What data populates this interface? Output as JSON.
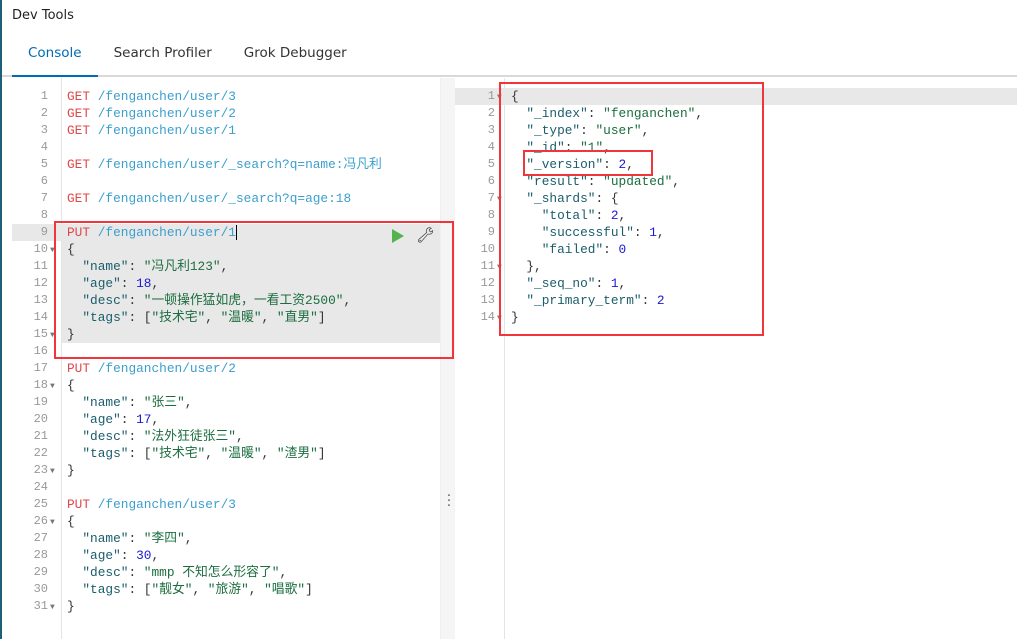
{
  "app": {
    "title": "Dev Tools"
  },
  "tabs": [
    {
      "label": "Console",
      "active": true
    },
    {
      "label": "Search Profiler"
    },
    {
      "label": "Grok Debugger"
    }
  ],
  "colors": {
    "accent": "#006bb4",
    "highlight_box": "#f0363a",
    "method": "#e0484a",
    "url": "#3b9fcd"
  },
  "editor": {
    "fold_lines": [
      10,
      15,
      18,
      23,
      26,
      31
    ],
    "active_line": 9,
    "lines": [
      [
        [
          "m",
          "GET"
        ],
        [
          "u",
          " /fenganchen/user/3"
        ]
      ],
      [
        [
          "m",
          "GET"
        ],
        [
          "u",
          " /fenganchen/user/2"
        ]
      ],
      [
        [
          "m",
          "GET"
        ],
        [
          "u",
          " /fenganchen/user/1"
        ]
      ],
      [],
      [
        [
          "m",
          "GET"
        ],
        [
          "u",
          " /fenganchen/user/_search?q=name:冯凡利"
        ]
      ],
      [],
      [
        [
          "m",
          "GET"
        ],
        [
          "u",
          " /fenganchen/user/_search?q=age:18"
        ]
      ],
      [],
      [
        [
          "m",
          "PUT"
        ],
        [
          "u",
          " /fenganchen/user/1"
        ]
      ],
      [
        [
          "p",
          "{"
        ]
      ],
      [
        [
          "p",
          "  "
        ],
        [
          "k",
          "\"name\""
        ],
        [
          "p",
          ": "
        ],
        [
          "s",
          "\"冯凡利123\""
        ],
        [
          "p",
          ","
        ]
      ],
      [
        [
          "p",
          "  "
        ],
        [
          "k",
          "\"age\""
        ],
        [
          "p",
          ": "
        ],
        [
          "n",
          "18"
        ],
        [
          "p",
          ","
        ]
      ],
      [
        [
          "p",
          "  "
        ],
        [
          "k",
          "\"desc\""
        ],
        [
          "p",
          ": "
        ],
        [
          "s",
          "\"一顿操作猛如虎，一看工资2500\""
        ],
        [
          "p",
          ","
        ]
      ],
      [
        [
          "p",
          "  "
        ],
        [
          "k",
          "\"tags\""
        ],
        [
          "p",
          ": ["
        ],
        [
          "s",
          "\"技术宅\""
        ],
        [
          "p",
          ", "
        ],
        [
          "s",
          "\"温暖\""
        ],
        [
          "p",
          ", "
        ],
        [
          "s",
          "\"直男\""
        ],
        [
          "p",
          "]"
        ]
      ],
      [
        [
          "p",
          "}"
        ]
      ],
      [],
      [
        [
          "m",
          "PUT"
        ],
        [
          "u",
          " /fenganchen/user/2"
        ]
      ],
      [
        [
          "p",
          "{"
        ]
      ],
      [
        [
          "p",
          "  "
        ],
        [
          "k",
          "\"name\""
        ],
        [
          "p",
          ": "
        ],
        [
          "s",
          "\"张三\""
        ],
        [
          "p",
          ","
        ]
      ],
      [
        [
          "p",
          "  "
        ],
        [
          "k",
          "\"age\""
        ],
        [
          "p",
          ": "
        ],
        [
          "n",
          "17"
        ],
        [
          "p",
          ","
        ]
      ],
      [
        [
          "p",
          "  "
        ],
        [
          "k",
          "\"desc\""
        ],
        [
          "p",
          ": "
        ],
        [
          "s",
          "\"法外狂徒张三\""
        ],
        [
          "p",
          ","
        ]
      ],
      [
        [
          "p",
          "  "
        ],
        [
          "k",
          "\"tags\""
        ],
        [
          "p",
          ": ["
        ],
        [
          "s",
          "\"技术宅\""
        ],
        [
          "p",
          ", "
        ],
        [
          "s",
          "\"温暖\""
        ],
        [
          "p",
          ", "
        ],
        [
          "s",
          "\"渣男\""
        ],
        [
          "p",
          "]"
        ]
      ],
      [
        [
          "p",
          "}"
        ]
      ],
      [],
      [
        [
          "m",
          "PUT"
        ],
        [
          "u",
          " /fenganchen/user/3"
        ]
      ],
      [
        [
          "p",
          "{"
        ]
      ],
      [
        [
          "p",
          "  "
        ],
        [
          "k",
          "\"name\""
        ],
        [
          "p",
          ": "
        ],
        [
          "s",
          "\"李四\""
        ],
        [
          "p",
          ","
        ]
      ],
      [
        [
          "p",
          "  "
        ],
        [
          "k",
          "\"age\""
        ],
        [
          "p",
          ": "
        ],
        [
          "n",
          "30"
        ],
        [
          "p",
          ","
        ]
      ],
      [
        [
          "p",
          "  "
        ],
        [
          "k",
          "\"desc\""
        ],
        [
          "p",
          ": "
        ],
        [
          "s",
          "\"mmp 不知怎么形容了\""
        ],
        [
          "p",
          ","
        ]
      ],
      [
        [
          "p",
          "  "
        ],
        [
          "k",
          "\"tags\""
        ],
        [
          "p",
          ": ["
        ],
        [
          "s",
          "\"靓女\""
        ],
        [
          "p",
          ", "
        ],
        [
          "s",
          "\"旅游\""
        ],
        [
          "p",
          ", "
        ],
        [
          "s",
          "\"唱歌\""
        ],
        [
          "p",
          "]"
        ]
      ],
      [
        [
          "p",
          "}"
        ]
      ]
    ]
  },
  "output": {
    "fold_lines": [
      1,
      7,
      11,
      14
    ],
    "lines": [
      [
        [
          "p",
          "{"
        ]
      ],
      [
        [
          "p",
          "  "
        ],
        [
          "k",
          "\"_index\""
        ],
        [
          "p",
          ": "
        ],
        [
          "s",
          "\"fenganchen\""
        ],
        [
          "p",
          ","
        ]
      ],
      [
        [
          "p",
          "  "
        ],
        [
          "k",
          "\"_type\""
        ],
        [
          "p",
          ": "
        ],
        [
          "s",
          "\"user\""
        ],
        [
          "p",
          ","
        ]
      ],
      [
        [
          "p",
          "  "
        ],
        [
          "k",
          "\"_id\""
        ],
        [
          "p",
          ": "
        ],
        [
          "s",
          "\"1\""
        ],
        [
          "p",
          ","
        ]
      ],
      [
        [
          "p",
          "  "
        ],
        [
          "k",
          "\"_version\""
        ],
        [
          "p",
          ": "
        ],
        [
          "n",
          "2"
        ],
        [
          "p",
          ","
        ]
      ],
      [
        [
          "p",
          "  "
        ],
        [
          "k",
          "\"result\""
        ],
        [
          "p",
          ": "
        ],
        [
          "s",
          "\"updated\""
        ],
        [
          "p",
          ","
        ]
      ],
      [
        [
          "p",
          "  "
        ],
        [
          "k",
          "\"_shards\""
        ],
        [
          "p",
          ": {"
        ]
      ],
      [
        [
          "p",
          "    "
        ],
        [
          "k",
          "\"total\""
        ],
        [
          "p",
          ": "
        ],
        [
          "n",
          "2"
        ],
        [
          "p",
          ","
        ]
      ],
      [
        [
          "p",
          "    "
        ],
        [
          "k",
          "\"successful\""
        ],
        [
          "p",
          ": "
        ],
        [
          "n",
          "1"
        ],
        [
          "p",
          ","
        ]
      ],
      [
        [
          "p",
          "    "
        ],
        [
          "k",
          "\"failed\""
        ],
        [
          "p",
          ": "
        ],
        [
          "n",
          "0"
        ]
      ],
      [
        [
          "p",
          "  },"
        ]
      ],
      [
        [
          "p",
          "  "
        ],
        [
          "k",
          "\"_seq_no\""
        ],
        [
          "p",
          ": "
        ],
        [
          "n",
          "1"
        ],
        [
          "p",
          ","
        ]
      ],
      [
        [
          "p",
          "  "
        ],
        [
          "k",
          "\"_primary_term\""
        ],
        [
          "p",
          ": "
        ],
        [
          "n",
          "2"
        ]
      ],
      [
        [
          "p",
          "}"
        ]
      ]
    ]
  },
  "icons": {
    "run": "play-icon",
    "settings": "wrench-icon",
    "splitter": "vertical-dots-icon"
  }
}
